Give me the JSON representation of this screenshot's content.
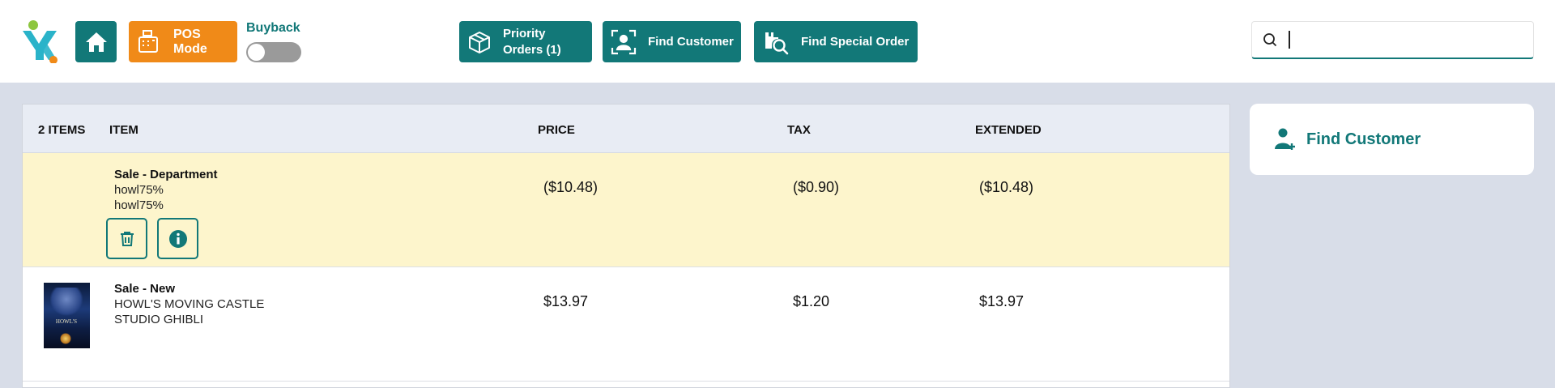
{
  "header": {
    "pos_mode_label": "POS Mode",
    "buyback_label": "Buyback",
    "buyback_enabled": false,
    "priority_orders_label_line1": "Priority",
    "priority_orders_label_line2": "Orders (1)",
    "find_customer_label": "Find Customer",
    "find_special_order_label": "Find Special Order",
    "search_value": ""
  },
  "cart": {
    "columns": {
      "count": "2 ITEMS",
      "item": "ITEM",
      "price": "PRICE",
      "tax": "TAX",
      "extended": "EXTENDED"
    },
    "rows": [
      {
        "title": "Sale - Department",
        "line1": "howl75%",
        "line2": "howl75%",
        "price": "($10.48)",
        "tax": "($0.90)",
        "extended": "($10.48)"
      },
      {
        "title": "Sale - New",
        "line1": "HOWL'S MOVING CASTLE",
        "line2": "STUDIO GHIBLI",
        "price": "$13.97",
        "tax": "$1.20",
        "extended": "$13.97"
      }
    ]
  },
  "side_panel": {
    "find_customer_label": "Find Customer"
  },
  "colors": {
    "teal": "#127878",
    "orange": "#f08a18",
    "highlight_row": "#fdf5cc",
    "background": "#d8dde8"
  }
}
